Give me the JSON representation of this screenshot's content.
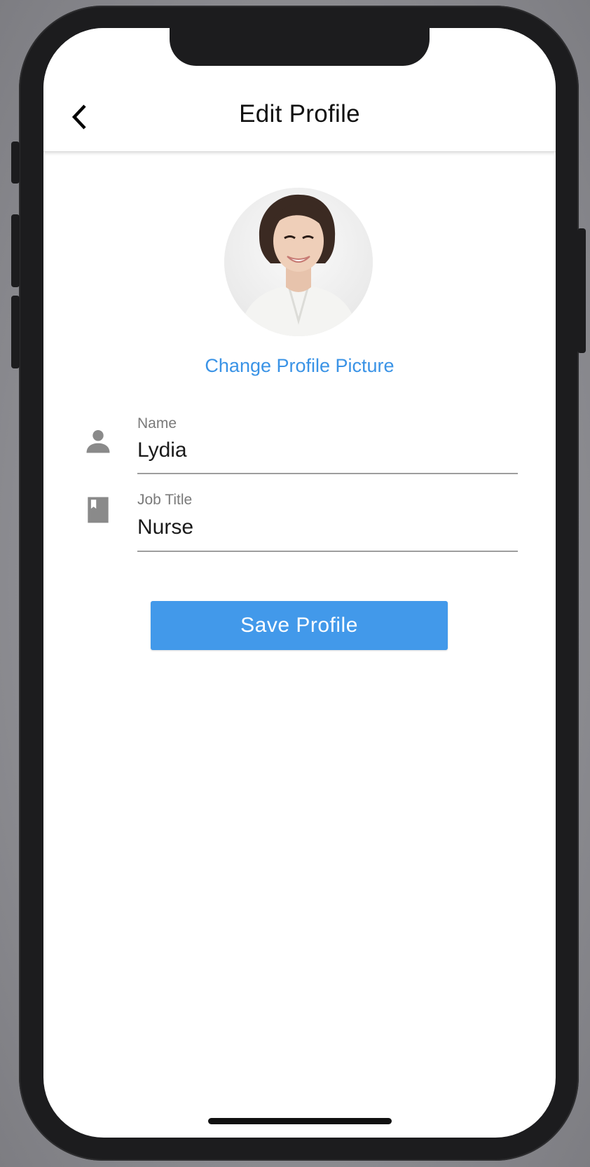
{
  "header": {
    "title": "Edit Profile",
    "back_icon": "chevron-left-icon"
  },
  "profile": {
    "avatar_alt": "Profile photo",
    "change_picture_label": "Change Profile Picture"
  },
  "form": {
    "fields": [
      {
        "label": "Name",
        "value": "Lydia",
        "icon": "person-icon"
      },
      {
        "label": "Job Title",
        "value": "Nurse",
        "icon": "book-icon"
      }
    ]
  },
  "actions": {
    "save_label": "Save Profile"
  },
  "colors": {
    "accent": "#4299ea",
    "link": "#3a93e6",
    "icon_gray": "#8a8a8a",
    "device_frame": "#1c1c1e"
  }
}
